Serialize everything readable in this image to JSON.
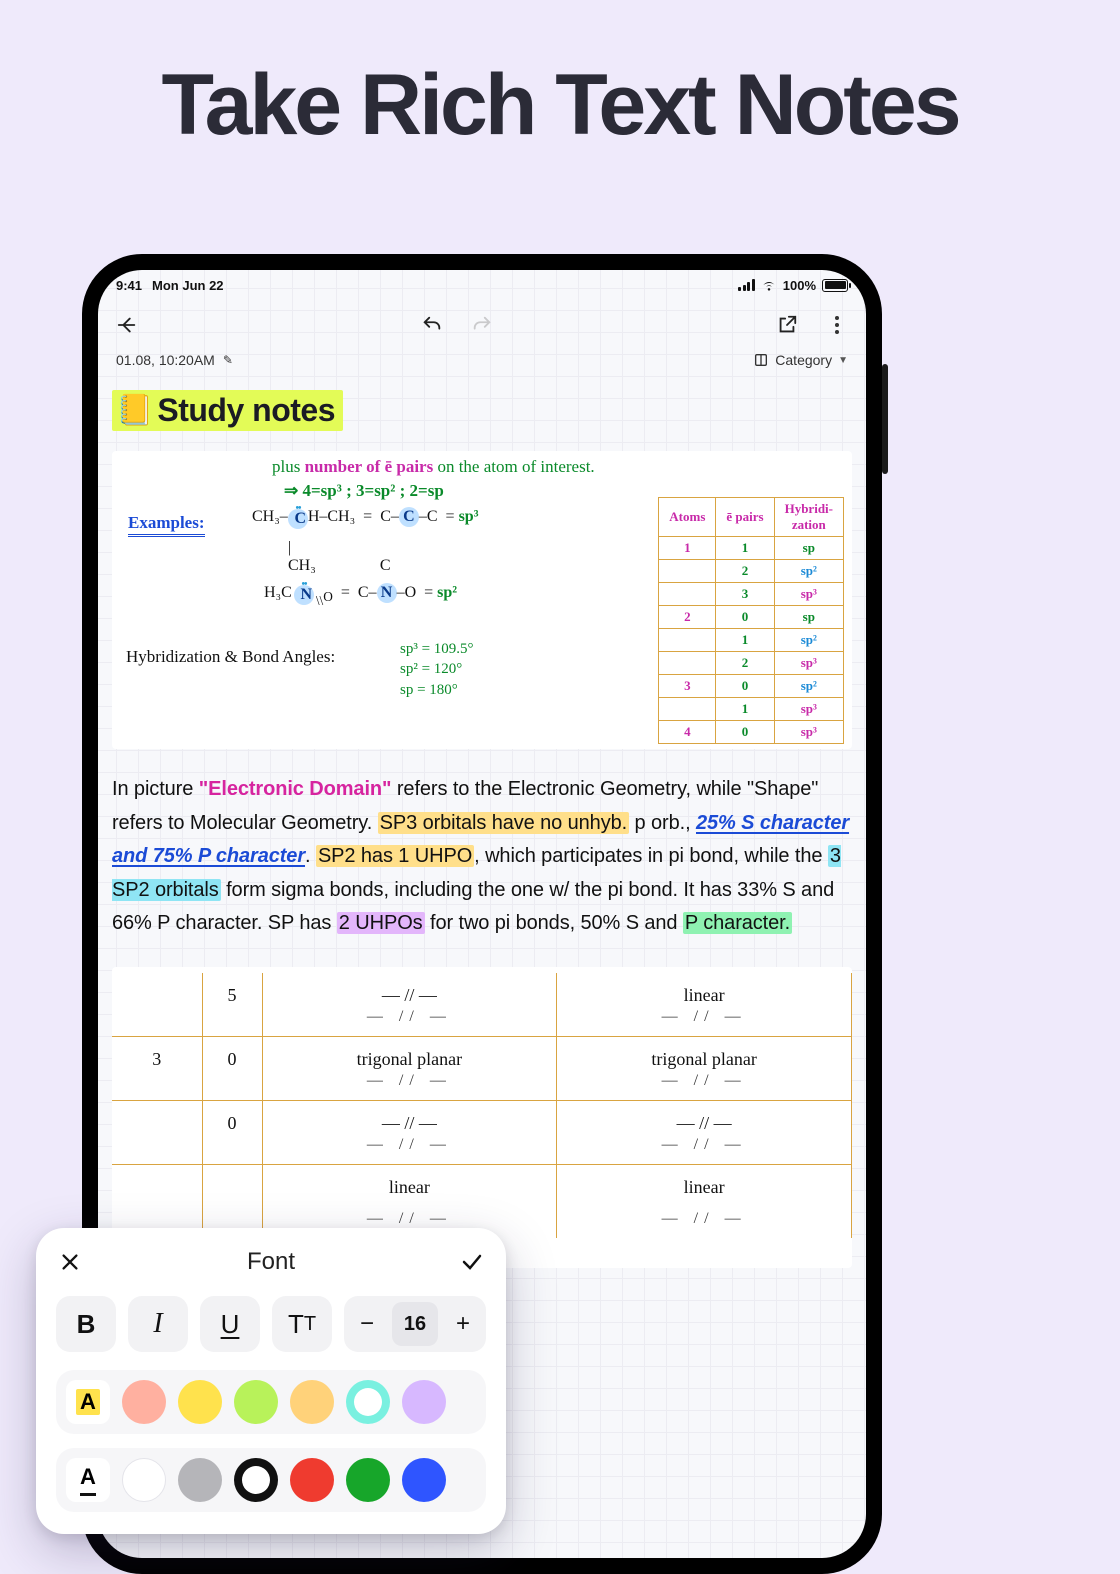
{
  "hero": {
    "title": "Take Rich Text Notes"
  },
  "status": {
    "time": "9:41",
    "date": "Mon Jun 22",
    "battery_pct": "100%"
  },
  "toolbar": {
    "back": "Back",
    "undo": "Undo",
    "redo": "Redo",
    "share": "Share",
    "more": "More"
  },
  "meta": {
    "timestamp": "01.08, 10:20AM",
    "category_label": "Category"
  },
  "note": {
    "title": "Study notes",
    "hand": {
      "plus": "plus ",
      "plus_em": "number of ē pairs",
      "plus_tail": " on the atom of interest.",
      "arrow": "⇒ 4=sp³ ; 3=sp² ; 2=sp",
      "examples": "Examples:",
      "chem1": "CH₃–C–CH₃  =  C–C–C  = sp³",
      "chem1b": "CH₃",
      "chem3": "H₃C–N=O   =  C–N–O  = sp²",
      "hbond": "Hybridization & Bond Angles:",
      "ang1": "sp³ = 109.5°",
      "ang2": "sp² = 120°",
      "ang3": "sp  = 180°",
      "table": {
        "h1": "Atoms",
        "h2": "ē pairs",
        "h3": "Hybridi-\nzation",
        "rows": [
          {
            "a": "1",
            "e": "1",
            "h": "sp",
            "hc": "sp1"
          },
          {
            "a": "",
            "e": "2",
            "h": "sp²",
            "hc": "sp2"
          },
          {
            "a": "",
            "e": "3",
            "h": "sp³",
            "hc": "sp3"
          },
          {
            "a": "2",
            "e": "0",
            "h": "sp",
            "hc": "sp1"
          },
          {
            "a": "",
            "e": "1",
            "h": "sp²",
            "hc": "sp2"
          },
          {
            "a": "",
            "e": "2",
            "h": "sp³",
            "hc": "sp3"
          },
          {
            "a": "3",
            "e": "0",
            "h": "sp²",
            "hc": "sp2"
          },
          {
            "a": "",
            "e": "1",
            "h": "sp³",
            "hc": "sp3"
          },
          {
            "a": "4",
            "e": "0",
            "h": "sp³",
            "hc": "sp3"
          }
        ]
      }
    },
    "body": {
      "p1a": "In picture ",
      "p1b": "\"Electronic Domain\"",
      "p1c": " refers to the Electronic Geometry, while \"Shape\" refers to Molecular Geometry. ",
      "p1d": "SP3 orbitals have no unhyb.",
      "p1e": " p orb., ",
      "p1f": "25% S character and 75% P character",
      "p1g": ". ",
      "p1h": "SP2 has 1 UHPO",
      "p1i": ", which participates in pi bond, while the ",
      "p1j": "3 SP2 orbitals",
      "p1k": " form sigma bonds, including the one w/ the pi bond. It has 33% S and 66% P character. SP has ",
      "p1l": "2 UHPOs",
      "p1m": " for two pi bonds, 50% S and ",
      "p1n": "P character."
    },
    "geom": {
      "rows": [
        {
          "n": "",
          "z": "5",
          "c3": "— // —",
          "c4": "linear"
        },
        {
          "n": "3",
          "z": "0",
          "c3": "trigonal planar",
          "c4": "trigonal planar"
        },
        {
          "n": "",
          "z": "0",
          "c3": "— // —",
          "c4": "— // —"
        },
        {
          "n": "",
          "z": "",
          "c3": "linear",
          "c4": "linear"
        }
      ]
    }
  },
  "font_panel": {
    "title": "Font",
    "size": "16",
    "bold": "B",
    "italic": "I",
    "underline": "U",
    "minus": "−",
    "plus": "+",
    "hl_colors": [
      "#ffb0a0",
      "#ffe24d",
      "#b8f25a",
      "#ffd27a",
      "#7af0e0",
      "#d7b8ff"
    ],
    "text_colors": [
      "#ffffff",
      "#b5b5b9",
      "#111111",
      "#ef3b2f",
      "#17a62a",
      "#2f55ff"
    ]
  }
}
